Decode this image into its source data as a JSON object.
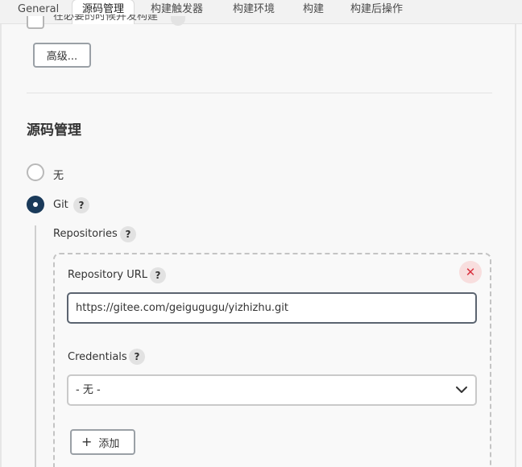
{
  "tabs": [
    "General",
    "源码管理",
    "构建触发器",
    "构建环境",
    "构建",
    "构建后操作"
  ],
  "advanced_label": "高级...",
  "section_title": "源码管理",
  "scm_options": {
    "none": "无",
    "git": "Git"
  },
  "help_glyph": "?",
  "repositories_label": "Repositories",
  "repository_url_label": "Repository URL",
  "repository_url_value": "https://gitee.com/geigugugu/yizhizhu.git",
  "credentials_label": "Credentials",
  "credentials_selected": "- 无 -",
  "add_label": "添加",
  "close_glyph": "✕",
  "plus_glyph": "+",
  "partial_checkbox_text": "在必要的时候并发构建",
  "colors": {
    "radio_selected": "#1a3a5a",
    "remove_button_bg": "#f8dede",
    "remove_button_fg": "#d9323f"
  },
  "icons": {
    "remove": "close-icon",
    "dropdown": "chevron-down-icon",
    "add": "plus-icon",
    "help": "help-icon"
  }
}
